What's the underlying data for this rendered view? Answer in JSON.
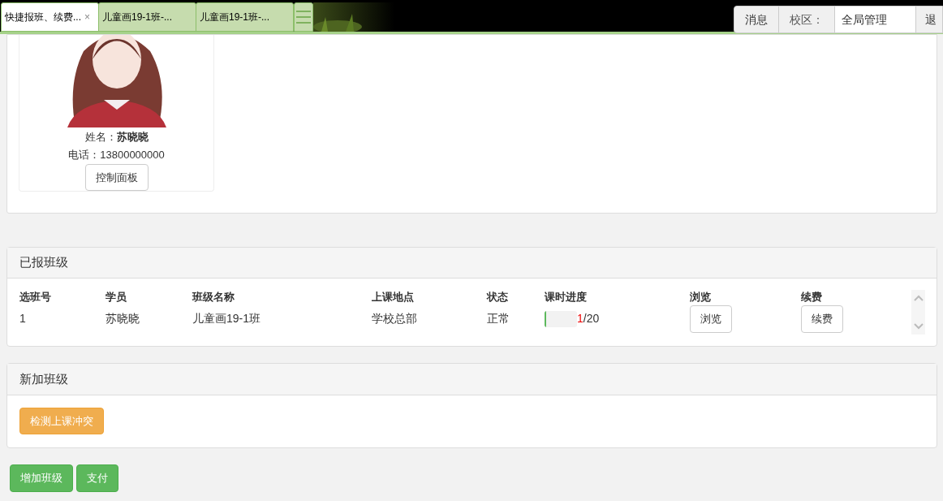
{
  "tabs": [
    {
      "label": "快捷报班、续费...",
      "selected": true,
      "close": "×"
    },
    {
      "label": "儿童画19-1班-...",
      "selected": false
    },
    {
      "label": "儿童画19-1班-...",
      "selected": false
    }
  ],
  "top_menu": {
    "messages": "消息",
    "campus_label": "校区：",
    "campus_value": "全局管理",
    "logout": "退"
  },
  "student": {
    "name": "姓名：**苏晓晓**",
    "phone": "电话：13800000000",
    "control_button": "控制面板"
  },
  "enrolled": {
    "title": "已报班级",
    "columns": [
      "选班号",
      "学员",
      "班级名称",
      "上课地点",
      "状态",
      "课时进度",
      "浏览",
      "续费"
    ],
    "rows": [
      {
        "id": "1",
        "student": "苏晓晓",
        "class_name": "儿童画19-1班",
        "location": "学校总部",
        "status": "正常",
        "progress": {
          "level": 0.05,
          "done": "1",
          "total": "/20"
        },
        "browse": "浏览",
        "renew": "续费"
      }
    ]
  },
  "new_class": {
    "title": "新加班级",
    "check_button": "检测上课冲突"
  },
  "buttons": [
    "增加班级",
    "支付"
  ]
}
